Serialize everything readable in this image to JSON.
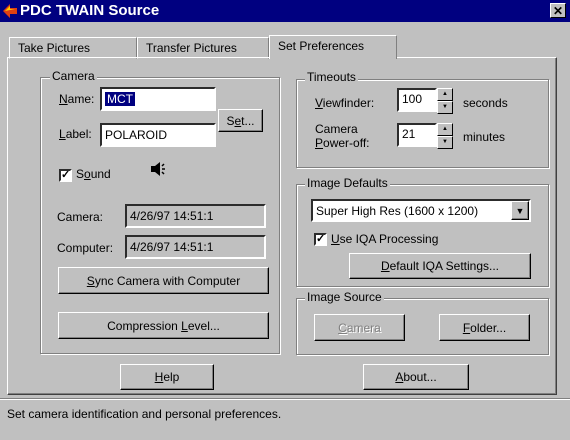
{
  "window": {
    "title": "PDC TWAIN Source",
    "close_label": "✕"
  },
  "tabs": [
    {
      "label": "Take Pictures"
    },
    {
      "label": "Transfer Pictures"
    },
    {
      "label": "Set Preferences"
    }
  ],
  "camera": {
    "group_label": "Camera",
    "name_label": "Name:",
    "name_value": "MCT",
    "label_label": "Label:",
    "label_value": "POLAROID",
    "set_button": "Set...",
    "sound_label": "Sound",
    "sound_checked": true,
    "camera_time_label": "Camera:",
    "camera_time_value": "4/26/97 14:51:1",
    "computer_time_label": "Computer:",
    "computer_time_value": "4/26/97 14:51:1",
    "sync_button": "Sync Camera with Computer",
    "compression_button": "Compression Level..."
  },
  "timeouts": {
    "group_label": "Timeouts",
    "viewfinder_label": "Viewfinder:",
    "viewfinder_value": "100",
    "viewfinder_unit": "seconds",
    "poweroff_label_line1": "Camera",
    "poweroff_label_line2": "Power-off:",
    "poweroff_value": "21",
    "poweroff_unit": "minutes"
  },
  "image_defaults": {
    "group_label": "Image Defaults",
    "resolution_selected": "Super High Res (1600 x 1200)",
    "iqa_label": "Use IQA Processing",
    "iqa_checked": true,
    "default_iqa_button": "Default IQA Settings..."
  },
  "image_source": {
    "group_label": "Image Source",
    "camera_button": "Camera",
    "folder_button": "Folder..."
  },
  "bottom": {
    "help_button": "Help",
    "about_button": "About..."
  },
  "status": {
    "text": "Set camera identification and personal preferences."
  }
}
